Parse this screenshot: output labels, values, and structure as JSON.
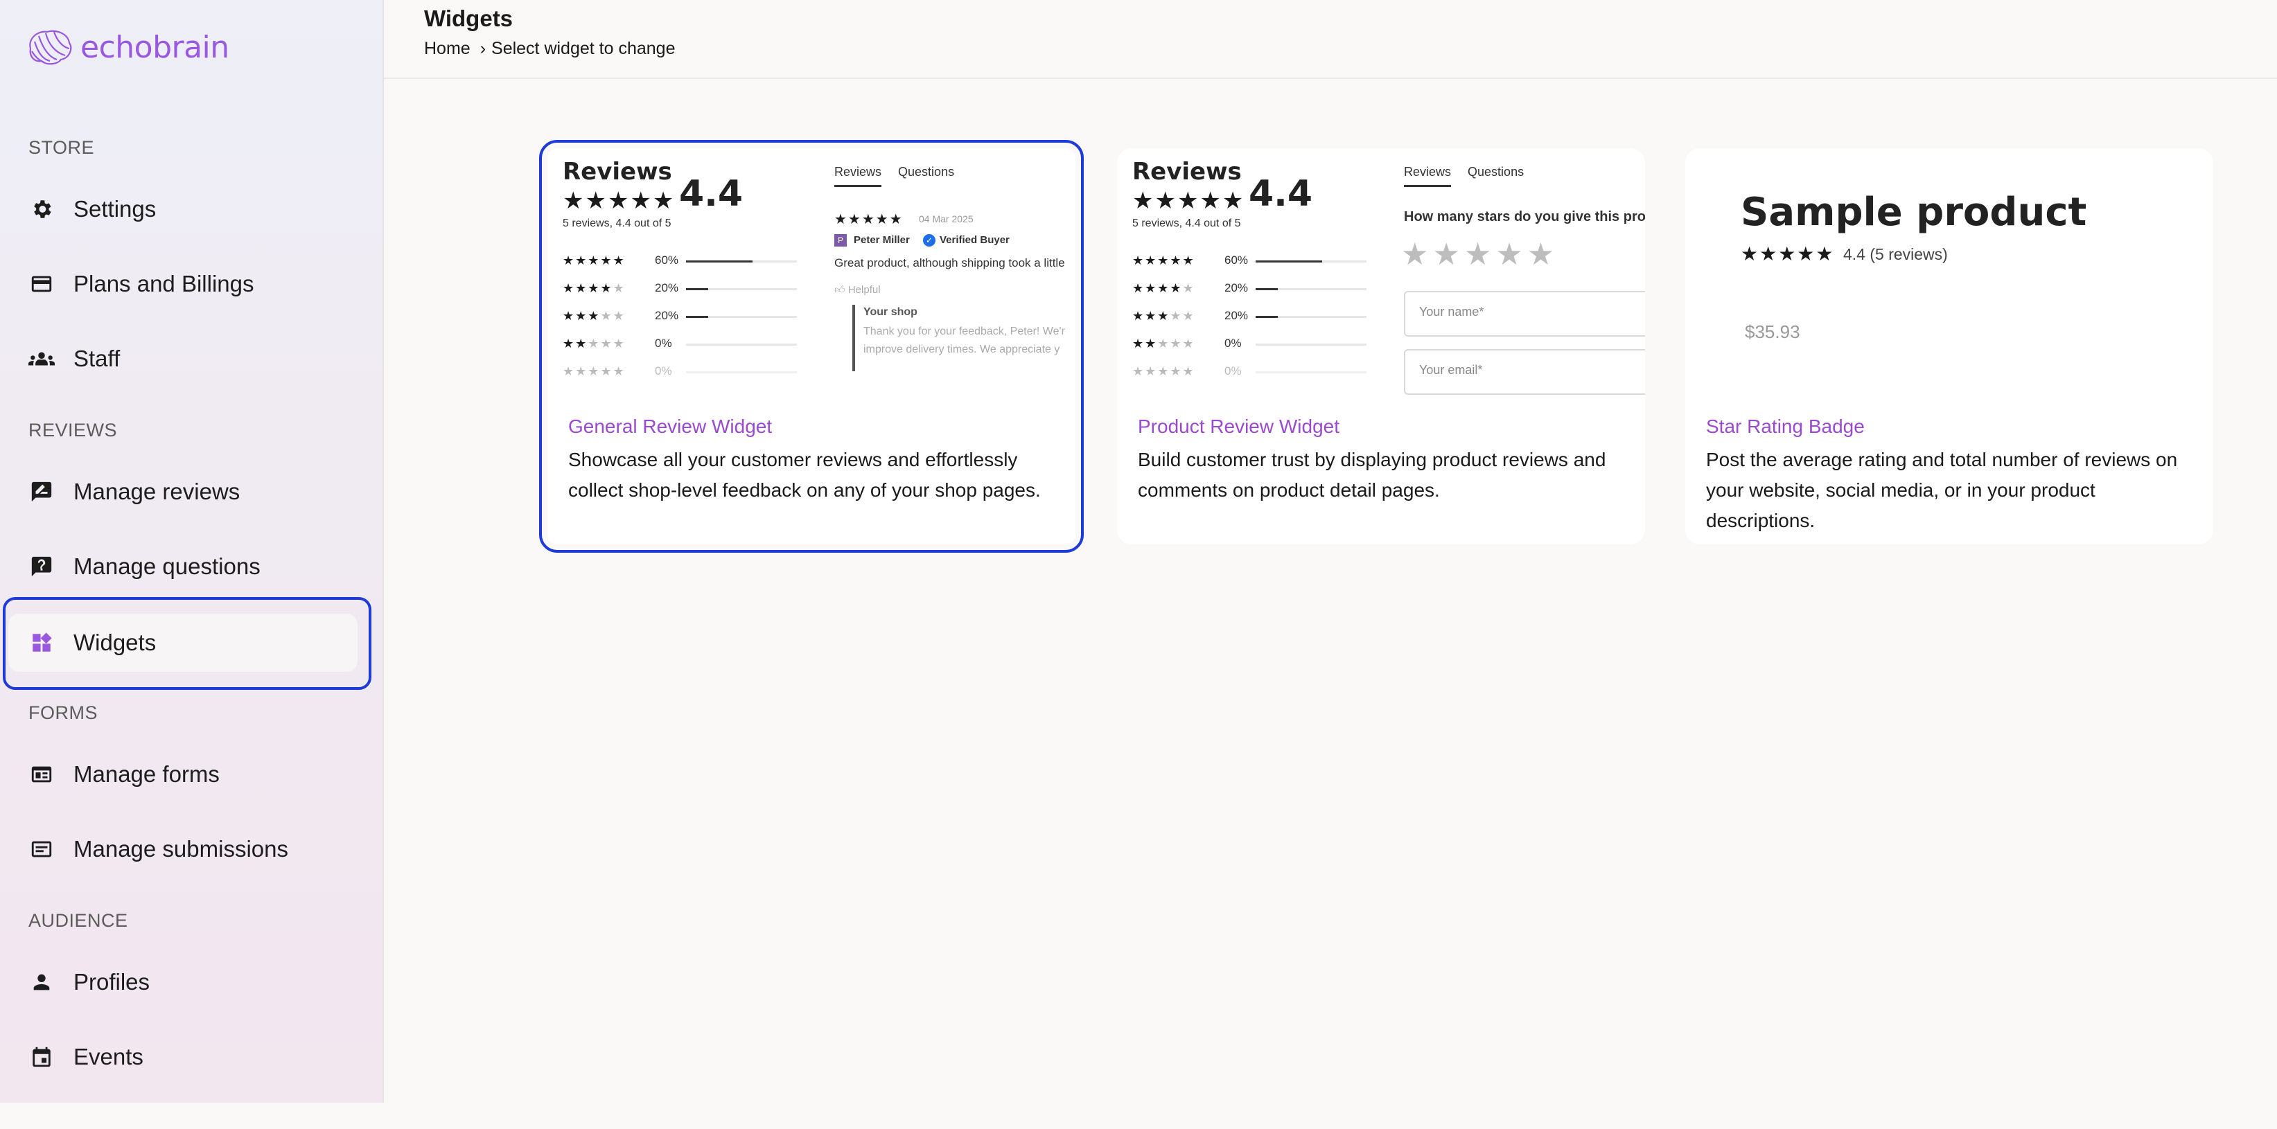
{
  "app": {
    "logo_text": "echobrain",
    "accent": "#9a58e0",
    "selection_color": "#1e3ad8"
  },
  "sidebar": {
    "sections": [
      {
        "label": "STORE"
      },
      {
        "label": "REVIEWS"
      },
      {
        "label": "FORMS"
      },
      {
        "label": "AUDIENCE"
      }
    ],
    "items": [
      {
        "label": "Settings",
        "icon": "gear-icon"
      },
      {
        "label": "Plans and Billings",
        "icon": "credit-card-icon"
      },
      {
        "label": "Staff",
        "icon": "people-icon"
      },
      {
        "label": "Manage reviews",
        "icon": "rate-review-icon"
      },
      {
        "label": "Manage questions",
        "icon": "question-icon"
      },
      {
        "label": "Widgets",
        "icon": "widgets-icon",
        "active": true
      },
      {
        "label": "Manage forms",
        "icon": "form-icon"
      },
      {
        "label": "Manage submissions",
        "icon": "submissions-icon"
      },
      {
        "label": "Profiles",
        "icon": "person-icon"
      },
      {
        "label": "Events",
        "icon": "calendar-icon"
      }
    ]
  },
  "header": {
    "title": "Widgets",
    "breadcrumb": {
      "home": "Home",
      "separator": "›",
      "current": "Select widget to change"
    }
  },
  "widgets": [
    {
      "title": "General Review Widget",
      "description": "Showcase all your customer reviews and effortlessly collect shop-level feedback on any of your shop pages.",
      "selected": true,
      "preview": {
        "heading": "Reviews",
        "rating": "4.4",
        "summary": "5 reviews, 4.4 out of 5",
        "tabs": [
          "Reviews",
          "Questions"
        ],
        "distribution": [
          "60%",
          "20%",
          "20%",
          "0%",
          "0%"
        ],
        "distribution_values": [
          0.6,
          0.2,
          0.2,
          0,
          0
        ],
        "review_date": "04 Mar 2025",
        "reviewer_initial": "P",
        "reviewer": "Peter Miller",
        "verified": "Verified Buyer",
        "review_text": "Great product, although shipping took a little",
        "helpful": "Helpful",
        "reply_label": "Your shop",
        "reply_line1": "Thank you for your feedback, Peter! We'r",
        "reply_line2": "improve delivery times. We appreciate y"
      }
    },
    {
      "title": "Product Review Widget",
      "description": "Build customer trust by displaying product reviews and comments on product detail pages.",
      "selected": false,
      "preview": {
        "heading": "Reviews",
        "rating": "4.4",
        "summary": "5 reviews, 4.4 out of 5",
        "tabs": [
          "Reviews",
          "Questions"
        ],
        "distribution": [
          "60%",
          "20%",
          "20%",
          "0%",
          "0%"
        ],
        "distribution_values": [
          0.6,
          0.2,
          0.2,
          0,
          0
        ],
        "question": "How many stars do you give this product?",
        "name_placeholder": "Your name*",
        "email_placeholder": "Your email*"
      }
    },
    {
      "title": "Star Rating Badge",
      "description": "Post the average rating and total number of reviews on your website, social media, or in your product descriptions.",
      "selected": false,
      "preview": {
        "product": "Sample product",
        "rating_text": "4.4 (5 reviews)",
        "price": "$35.93"
      }
    }
  ]
}
